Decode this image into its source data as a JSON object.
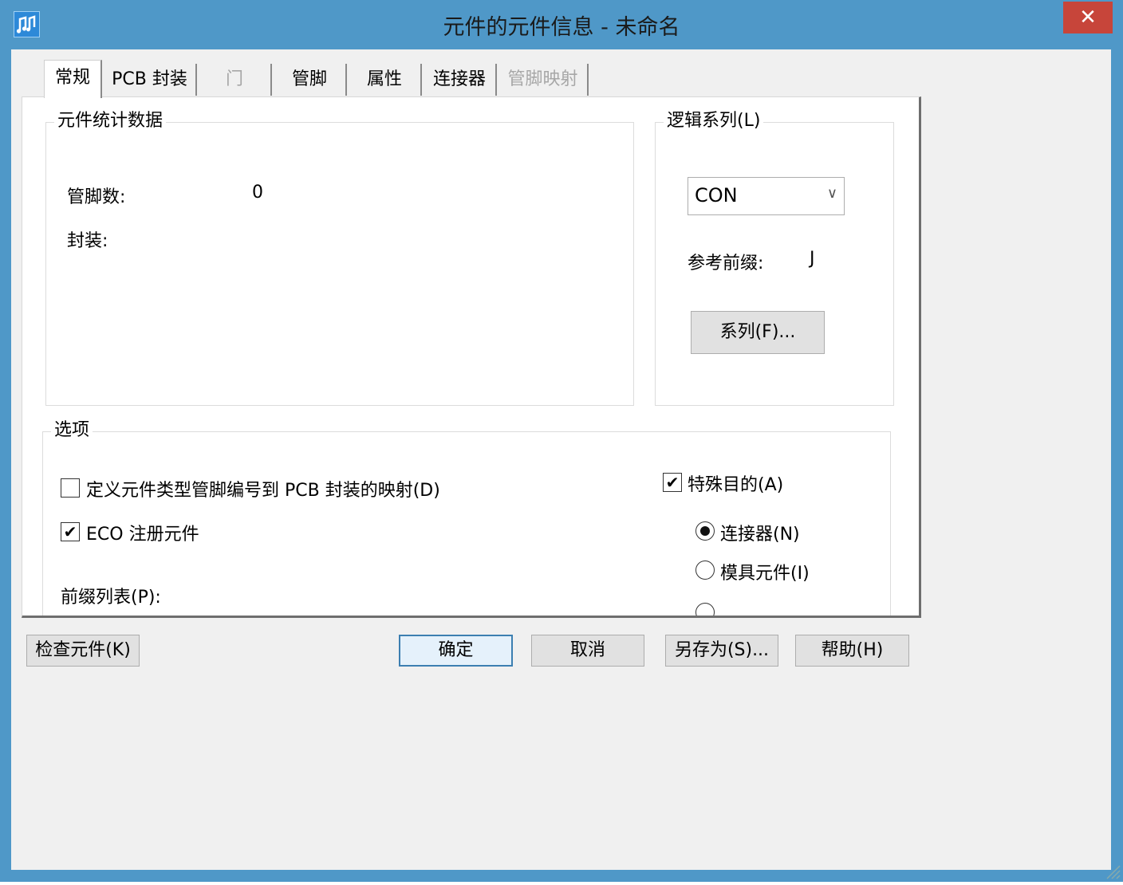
{
  "window": {
    "title": "元件的元件信息 - 未命名",
    "close_glyph": "✕",
    "app_icon": "music-notes-icon"
  },
  "tabs": [
    {
      "label": "常规",
      "state": "active"
    },
    {
      "label": "PCB 封装",
      "state": "normal"
    },
    {
      "label": "门",
      "state": "disabled"
    },
    {
      "label": "管脚",
      "state": "normal"
    },
    {
      "label": "属性",
      "state": "normal"
    },
    {
      "label": "连接器",
      "state": "normal"
    },
    {
      "label": "管脚映射",
      "state": "disabled"
    }
  ],
  "stats": {
    "legend": "元件统计数据",
    "pin_count_label": "管脚数:",
    "pin_count_value": "0",
    "package_label": "封装:"
  },
  "logic_family": {
    "legend": "逻辑系列(L)",
    "selected": "CON",
    "ref_prefix_label": "参考前缀:",
    "ref_prefix_value": "J",
    "family_button": "系列(F)..."
  },
  "options": {
    "legend": "选项",
    "define_mapping": {
      "label": "定义元件类型管脚编号到 PCB 封装的映射(D)",
      "checked": false
    },
    "eco_register": {
      "label": "ECO 注册元件",
      "checked": true
    },
    "prefix_list_label": "前缀列表(P):",
    "special_purpose": {
      "label": "特殊目的(A)",
      "checked": true
    },
    "radio_connector": {
      "label": "连接器(N)",
      "selected": true
    },
    "radio_die": {
      "label": "模具元件(I)",
      "selected": false
    }
  },
  "buttons": {
    "check": "检查元件(K)",
    "ok": "确定",
    "cancel": "取消",
    "save_as": "另存为(S)...",
    "help": "帮助(H)"
  },
  "colors": {
    "titlebar": "#4f98c8",
    "close": "#c7453a",
    "dialog_bg": "#f0f0f0"
  },
  "icons": {
    "close": "close-icon",
    "dropdown": "chevron-down-icon",
    "check": "checkmark-icon",
    "resize": "resize-grip-icon"
  }
}
